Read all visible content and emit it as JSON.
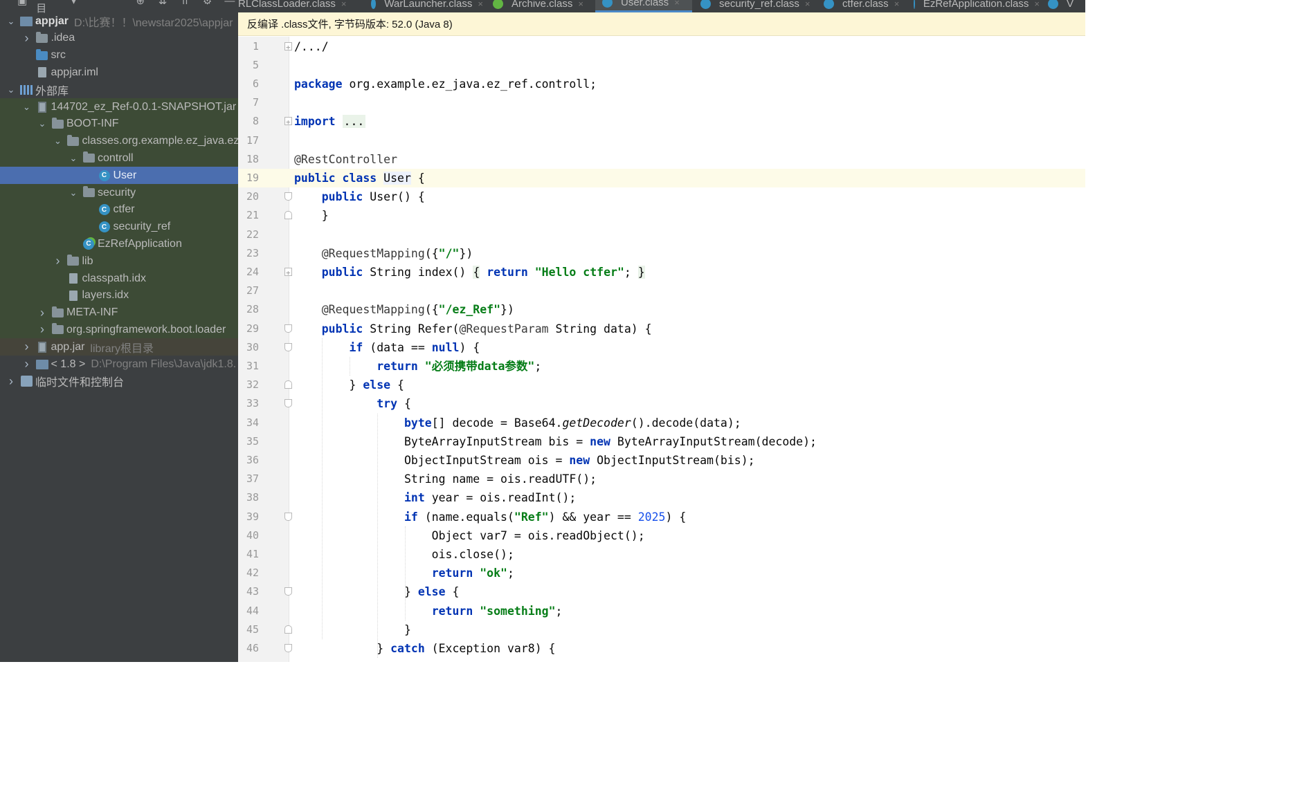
{
  "project_panel": {
    "title": "项目",
    "toolbar_icons": [
      "crosshair-icon",
      "collapse-all-icon",
      "expand-all-icon",
      "settings-gear-icon",
      "hide-icon"
    ],
    "tree": [
      {
        "depth": 0,
        "arrow": "down",
        "icon": "module",
        "name": "appjar",
        "bold": true,
        "path": "D:\\比赛！！\\newstar2025\\appjar"
      },
      {
        "depth": 1,
        "arrow": "right",
        "icon": "folder",
        "name": ".idea"
      },
      {
        "depth": 1,
        "arrow": "none",
        "icon": "folder-blue",
        "name": "src"
      },
      {
        "depth": 1,
        "arrow": "none",
        "icon": "file",
        "name": "appjar.iml"
      },
      {
        "depth": 0,
        "arrow": "down",
        "icon": "library",
        "name": "外部库"
      },
      {
        "depth": 1,
        "arrow": "down",
        "icon": "jar",
        "name": "144702_ez_Ref-0.0.1-SNAPSHOT.jar",
        "style": "highlight"
      },
      {
        "depth": 2,
        "arrow": "down",
        "icon": "folder",
        "name": "BOOT-INF",
        "style": "highlight"
      },
      {
        "depth": 3,
        "arrow": "down",
        "icon": "folder",
        "name": "classes.org.example.ez_java.ez_",
        "style": "highlight"
      },
      {
        "depth": 4,
        "arrow": "down",
        "icon": "folder",
        "name": "controll",
        "style": "highlight"
      },
      {
        "depth": 5,
        "arrow": "none",
        "icon": "class",
        "name": "User",
        "style": "selected"
      },
      {
        "depth": 4,
        "arrow": "down",
        "icon": "folder",
        "name": "security",
        "style": "highlight"
      },
      {
        "depth": 5,
        "arrow": "none",
        "icon": "class",
        "name": "ctfer",
        "style": "highlight"
      },
      {
        "depth": 5,
        "arrow": "none",
        "icon": "class",
        "name": "security_ref",
        "style": "highlight"
      },
      {
        "depth": 4,
        "arrow": "none",
        "icon": "class-spring",
        "name": "EzRefApplication",
        "style": "highlight"
      },
      {
        "depth": 3,
        "arrow": "right",
        "icon": "folder",
        "name": "lib",
        "style": "highlight"
      },
      {
        "depth": 3,
        "arrow": "none",
        "icon": "file",
        "name": "classpath.idx",
        "style": "highlight"
      },
      {
        "depth": 3,
        "arrow": "none",
        "icon": "file",
        "name": "layers.idx",
        "style": "highlight"
      },
      {
        "depth": 2,
        "arrow": "right",
        "icon": "folder",
        "name": "META-INF",
        "style": "highlight"
      },
      {
        "depth": 2,
        "arrow": "right",
        "icon": "folder",
        "name": "org.springframework.boot.loader",
        "style": "highlight"
      },
      {
        "depth": 1,
        "arrow": "right",
        "icon": "jar",
        "name": "app.jar",
        "path": "library根目录",
        "style": "lib"
      },
      {
        "depth": 1,
        "arrow": "right",
        "icon": "jdk",
        "name": "< 1.8 >",
        "path": "D:\\Program Files\\Java\\jdk1.8."
      },
      {
        "depth": 0,
        "arrow": "right",
        "icon": "scratch",
        "name": "临时文件和控制台"
      }
    ]
  },
  "tabs": [
    {
      "label": "RLClassLoader.class",
      "icon": "class"
    },
    {
      "label": "WarLauncher.class",
      "icon": "class"
    },
    {
      "label": "Archive.class",
      "icon": "archive"
    },
    {
      "label": "User.class",
      "icon": "class",
      "active": true
    },
    {
      "label": "security_ref.class",
      "icon": "class"
    },
    {
      "label": "ctfer.class",
      "icon": "class"
    },
    {
      "label": "EzRefApplication.class",
      "icon": "class"
    },
    {
      "label": "V",
      "icon": "class"
    }
  ],
  "banner": {
    "text": "反编译 .class文件, 字节码版本: 52.0 (Java 8)"
  },
  "editor": {
    "current_line": "19",
    "lines": [
      {
        "n": "1",
        "fold": "plus",
        "tokens": [
          [
            "",
            "/.../"
          ]
        ]
      },
      {
        "n": "5",
        "tokens": []
      },
      {
        "n": "6",
        "tokens": [
          [
            "kw",
            "package"
          ],
          [
            "",
            " org.example.ez_java.ez_ref.controll;"
          ]
        ]
      },
      {
        "n": "7",
        "tokens": []
      },
      {
        "n": "8",
        "fold": "plus",
        "tokens": [
          [
            "kw",
            "import"
          ],
          [
            "",
            " "
          ],
          [
            "dots",
            "..."
          ]
        ]
      },
      {
        "n": "17",
        "tokens": []
      },
      {
        "n": "18",
        "tokens": [
          [
            "ann",
            "@RestController"
          ]
        ]
      },
      {
        "n": "19",
        "tokens": [
          [
            "kw",
            "public class"
          ],
          [
            "",
            " "
          ],
          [
            "cls-hl",
            "User"
          ],
          [
            "",
            " {"
          ]
        ]
      },
      {
        "n": "20",
        "fold": "minus",
        "tokens": [
          [
            "",
            "    "
          ],
          [
            "kw",
            "public"
          ],
          [
            "",
            " User() {"
          ]
        ]
      },
      {
        "n": "21",
        "fold": "end",
        "tokens": [
          [
            "",
            "    }"
          ]
        ]
      },
      {
        "n": "22",
        "tokens": []
      },
      {
        "n": "23",
        "tokens": [
          [
            "",
            "    "
          ],
          [
            "ann",
            "@RequestMapping"
          ],
          [
            "",
            "({"
          ],
          [
            "str",
            "\"/\""
          ],
          [
            "",
            "})"
          ]
        ]
      },
      {
        "n": "24",
        "fold": "plus",
        "tokens": [
          [
            "",
            "    "
          ],
          [
            "kw",
            "public"
          ],
          [
            "",
            " String index() "
          ],
          [
            "brace-hl",
            "{"
          ],
          [
            "",
            " "
          ],
          [
            "kw",
            "return"
          ],
          [
            "",
            " "
          ],
          [
            "str",
            "\"Hello ctfer\""
          ],
          [
            "",
            "; "
          ],
          [
            "brace-hl",
            "}"
          ]
        ]
      },
      {
        "n": "27",
        "tokens": []
      },
      {
        "n": "28",
        "tokens": [
          [
            "",
            "    "
          ],
          [
            "ann",
            "@RequestMapping"
          ],
          [
            "",
            "({"
          ],
          [
            "str",
            "\"/ez_Ref\""
          ],
          [
            "",
            "})"
          ]
        ]
      },
      {
        "n": "29",
        "fold": "minus",
        "tokens": [
          [
            "",
            "    "
          ],
          [
            "kw",
            "public"
          ],
          [
            "",
            " String Refer("
          ],
          [
            "ann",
            "@RequestParam"
          ],
          [
            "",
            " String data) {"
          ]
        ]
      },
      {
        "n": "30",
        "fold": "minus",
        "tokens": [
          [
            "",
            "        "
          ],
          [
            "kw",
            "if"
          ],
          [
            "",
            " (data == "
          ],
          [
            "kw",
            "null"
          ],
          [
            "",
            ") {"
          ]
        ]
      },
      {
        "n": "31",
        "tokens": [
          [
            "",
            "            "
          ],
          [
            "kw",
            "return"
          ],
          [
            "",
            " "
          ],
          [
            "str",
            "\"必须携带data参数\""
          ],
          [
            "",
            ";"
          ]
        ]
      },
      {
        "n": "32",
        "fold": "end",
        "tokens": [
          [
            "",
            "        } "
          ],
          [
            "kw",
            "else"
          ],
          [
            "",
            " {"
          ]
        ]
      },
      {
        "n": "33",
        "fold": "minus",
        "tokens": [
          [
            "",
            "            "
          ],
          [
            "kw",
            "try"
          ],
          [
            "",
            " {"
          ]
        ]
      },
      {
        "n": "34",
        "tokens": [
          [
            "",
            "                "
          ],
          [
            "kw",
            "byte"
          ],
          [
            "",
            "[] decode = Base64."
          ],
          [
            "it",
            "getDecoder"
          ],
          [
            "",
            "().decode(data);"
          ]
        ]
      },
      {
        "n": "35",
        "tokens": [
          [
            "",
            "                ByteArrayInputStream bis = "
          ],
          [
            "kw",
            "new"
          ],
          [
            "",
            " ByteArrayInputStream(decode);"
          ]
        ]
      },
      {
        "n": "36",
        "tokens": [
          [
            "",
            "                ObjectInputStream ois = "
          ],
          [
            "kw",
            "new"
          ],
          [
            "",
            " ObjectInputStream(bis);"
          ]
        ]
      },
      {
        "n": "37",
        "tokens": [
          [
            "",
            "                String name = ois.readUTF();"
          ]
        ]
      },
      {
        "n": "38",
        "tokens": [
          [
            "",
            "                "
          ],
          [
            "kw",
            "int"
          ],
          [
            "",
            " year = ois.readInt();"
          ]
        ]
      },
      {
        "n": "39",
        "fold": "minus",
        "tokens": [
          [
            "",
            "                "
          ],
          [
            "kw",
            "if"
          ],
          [
            "",
            " (name.equals("
          ],
          [
            "str",
            "\"Ref\""
          ],
          [
            "",
            ") && year == "
          ],
          [
            "num",
            "2025"
          ],
          [
            "",
            ") {"
          ]
        ]
      },
      {
        "n": "40",
        "tokens": [
          [
            "",
            "                    Object var7 = ois.readObject();"
          ]
        ]
      },
      {
        "n": "41",
        "tokens": [
          [
            "",
            "                    ois.close();"
          ]
        ]
      },
      {
        "n": "42",
        "tokens": [
          [
            "",
            "                    "
          ],
          [
            "kw",
            "return"
          ],
          [
            "",
            " "
          ],
          [
            "str",
            "\"ok\""
          ],
          [
            "",
            ";"
          ]
        ]
      },
      {
        "n": "43",
        "fold": "minus",
        "tokens": [
          [
            "",
            "                } "
          ],
          [
            "kw",
            "else"
          ],
          [
            "",
            " {"
          ]
        ]
      },
      {
        "n": "44",
        "tokens": [
          [
            "",
            "                    "
          ],
          [
            "kw",
            "return"
          ],
          [
            "",
            " "
          ],
          [
            "str",
            "\"something\""
          ],
          [
            "",
            ";"
          ]
        ]
      },
      {
        "n": "45",
        "fold": "end",
        "tokens": [
          [
            "",
            "                }"
          ]
        ]
      },
      {
        "n": "46",
        "fold": "minus",
        "tokens": [
          [
            "",
            "            } "
          ],
          [
            "kw",
            "catch"
          ],
          [
            "",
            " (Exception var8) {"
          ]
        ]
      }
    ]
  },
  "colors": {
    "panel_bg": "#3c3f41",
    "selection": "#4b6eaf",
    "banner_bg": "#fdf6d6",
    "keyword": "#0033b3",
    "string": "#067d17",
    "number": "#1750eb"
  }
}
